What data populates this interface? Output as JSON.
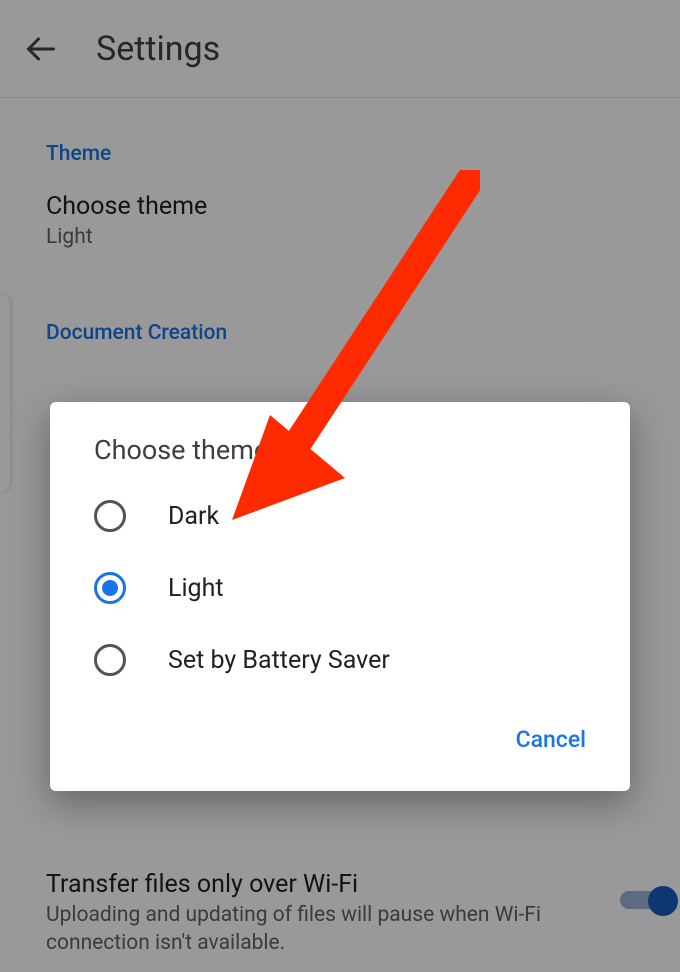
{
  "appbar": {
    "title": "Settings"
  },
  "sections": {
    "theme": {
      "heading": "Theme",
      "item_title": "Choose theme",
      "item_value": "Light"
    },
    "doc": {
      "heading": "Document Creation"
    },
    "wifi": {
      "title": "Transfer files only over Wi-Fi",
      "subtitle": "Uploading and updating of files will pause when Wi-Fi connection isn't available."
    }
  },
  "dialog": {
    "title": "Choose theme",
    "options": {
      "dark": "Dark",
      "light": "Light",
      "battery": "Set by Battery Saver"
    },
    "cancel": "Cancel"
  }
}
